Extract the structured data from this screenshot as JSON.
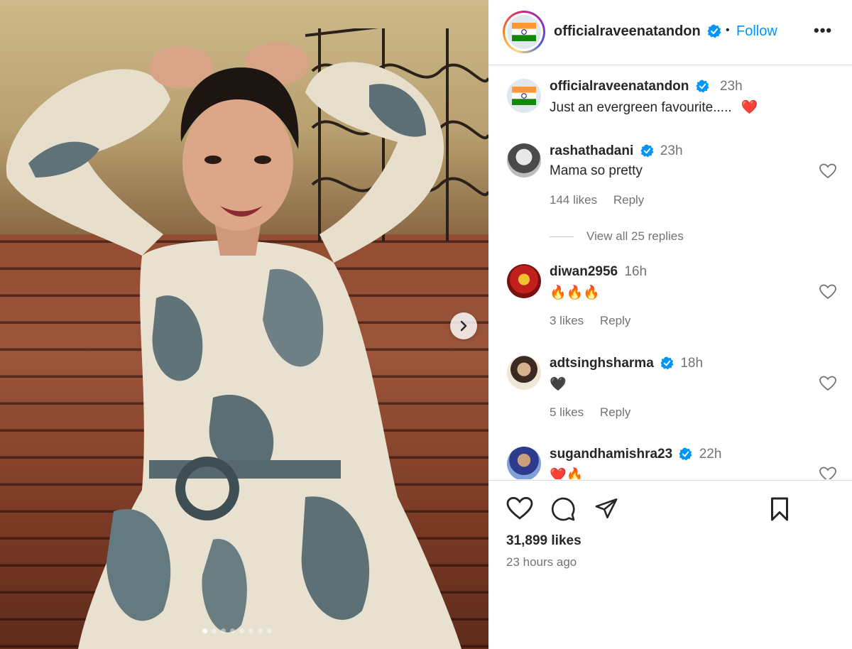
{
  "post": {
    "author": "officialraveenatandon",
    "follow_label": "Follow",
    "more_label": "•••",
    "separator": "•",
    "carousel_dots": 8,
    "carousel_active": 0
  },
  "caption": {
    "author": "officialraveenatandon",
    "time": "23h",
    "text": "Just an evergreen favourite.....",
    "emoji": "❤️"
  },
  "comments": [
    {
      "user": "rashathadani",
      "verified": true,
      "time": "23h",
      "text": "Mama so pretty",
      "likes": "144 likes",
      "reply": "Reply"
    },
    {
      "user": "diwan2956",
      "verified": false,
      "time": "16h",
      "text": "🔥🔥🔥",
      "likes": "3 likes",
      "reply": "Reply"
    },
    {
      "user": "adtsinghsharma",
      "verified": true,
      "time": "18h",
      "text": "🖤",
      "likes": "5 likes",
      "reply": "Reply"
    },
    {
      "user": "sugandhamishra23",
      "verified": true,
      "time": "22h",
      "text": "❤️🔥"
    }
  ],
  "view_replies": "View all 25 replies",
  "footer": {
    "likes": "31,899 likes",
    "time_ago": "23 hours ago"
  },
  "colors": {
    "link_blue": "#0095f6",
    "verified_blue": "#0095f6",
    "muted": "#737373",
    "text": "#262626"
  }
}
